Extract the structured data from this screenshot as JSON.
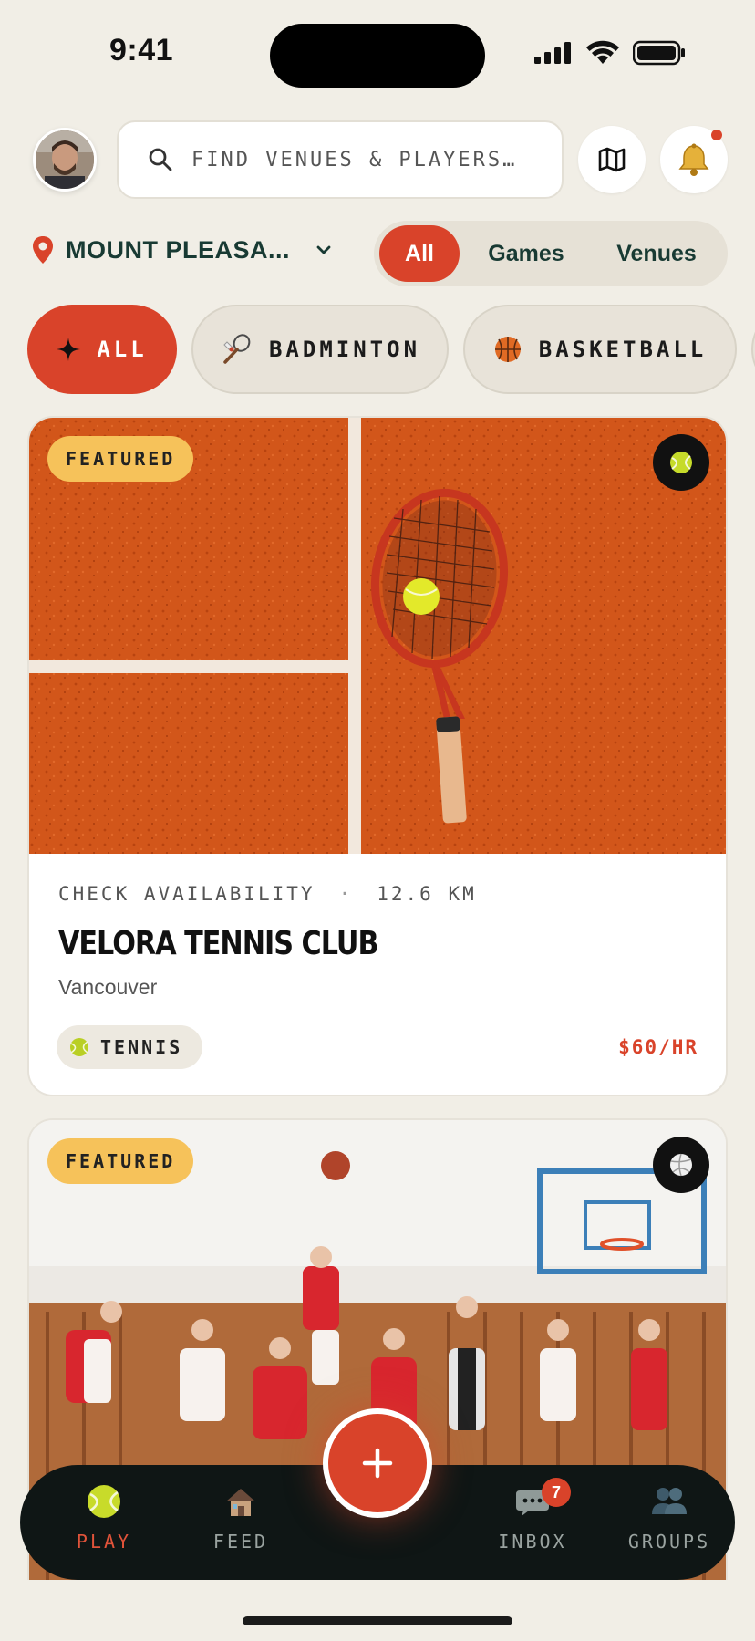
{
  "status_bar": {
    "time": "9:41"
  },
  "header": {
    "search_placeholder": "FIND VENUES & PLAYERS…",
    "map_icon": "map-icon",
    "notification_icon": "bell-icon"
  },
  "location": {
    "name": "MOUNT PLEASA..."
  },
  "segments": [
    {
      "label": "All",
      "active": true
    },
    {
      "label": "Games",
      "active": false
    },
    {
      "label": "Venues",
      "active": false
    }
  ],
  "sport_filters": [
    {
      "label": "ALL",
      "icon": "sparkle-icon",
      "active": true
    },
    {
      "label": "BADMINTON",
      "icon": "badminton-icon",
      "active": false
    },
    {
      "label": "BASKETBALL",
      "icon": "basketball-icon",
      "active": false
    }
  ],
  "cards": [
    {
      "badge": "FEATURED",
      "sport_icon": "tennis-ball-icon",
      "availability": "CHECK AVAILABILITY",
      "separator": "·",
      "distance": "12.6 KM",
      "name": "VELORA TENNIS CLUB",
      "city": "Vancouver",
      "sport_tag": "TENNIS",
      "price": "$60/HR"
    },
    {
      "badge": "FEATURED",
      "sport_icon": "volleyball-icon"
    }
  ],
  "bottom_nav": {
    "items": [
      {
        "label": "PLAY",
        "icon": "tennis-ball-icon",
        "active": true
      },
      {
        "label": "FEED",
        "icon": "house-icon",
        "active": false
      },
      {
        "label": "INBOX",
        "icon": "chat-bubble-icon",
        "active": false,
        "badge": "7"
      },
      {
        "label": "GROUPS",
        "icon": "people-icon",
        "active": false
      }
    ],
    "fab_label": "+"
  },
  "colors": {
    "accent": "#D9432A",
    "background": "#F1EEE6",
    "featured": "#F6C25A",
    "dark_green": "#183A33",
    "nav_bg": "#0F1615"
  }
}
